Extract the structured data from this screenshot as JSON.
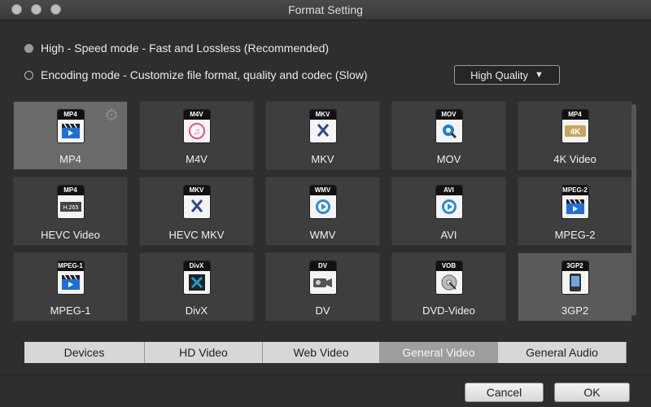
{
  "window": {
    "title": "Format Setting"
  },
  "modes": [
    {
      "label": "High - Speed mode - Fast and Lossless (Recommended)",
      "selected": true
    },
    {
      "label": "Encoding mode - Customize file format, quality and codec (Slow)",
      "selected": false
    }
  ],
  "quality": {
    "value": "High Quality",
    "arrow": "▼"
  },
  "formats": [
    {
      "label": "MP4",
      "badge": "MP4",
      "icon": "clapper-icon",
      "color": "#1e6fd9"
    },
    {
      "label": "M4V",
      "badge": "M4V",
      "icon": "itunes-icon",
      "color": "#e84a8a"
    },
    {
      "label": "MKV",
      "badge": "MKV",
      "icon": "mkv-logo-icon",
      "color": "#2a4d8a"
    },
    {
      "label": "MOV",
      "badge": "MOV",
      "icon": "quicktime-icon",
      "color": "#1f7fd6"
    },
    {
      "label": "4K Video",
      "badge": "MP4",
      "icon": "4k-icon",
      "color": "#c9a45c"
    },
    {
      "label": "HEVC Video",
      "badge": "MP4",
      "icon": "h265-icon",
      "color": "#444444"
    },
    {
      "label": "HEVC MKV",
      "badge": "MKV",
      "icon": "mkv-logo-icon",
      "color": "#2a4d8a"
    },
    {
      "label": "WMV",
      "badge": "WMV",
      "icon": "media-player-icon",
      "color": "#2c8adf"
    },
    {
      "label": "AVI",
      "badge": "AVI",
      "icon": "media-player-icon",
      "color": "#2c8adf"
    },
    {
      "label": "MPEG-2",
      "badge": "MPEG-2",
      "icon": "clapper-icon",
      "color": "#1e6fd9"
    },
    {
      "label": "MPEG-1",
      "badge": "MPEG-1",
      "icon": "clapper-icon",
      "color": "#1e6fd9"
    },
    {
      "label": "DivX",
      "badge": "DivX",
      "icon": "divx-icon",
      "color": "#1d9bd7"
    },
    {
      "label": "DV",
      "badge": "DV",
      "icon": "camcorder-icon",
      "color": "#555555"
    },
    {
      "label": "DVD-Video",
      "badge": "VOB",
      "icon": "dvd-disc-icon",
      "color": "#555555"
    },
    {
      "label": "3GP2",
      "badge": "3GP2",
      "icon": "phone-icon",
      "color": "#333333"
    }
  ],
  "selected_formats": [
    "MP4",
    "3GP2"
  ],
  "tabs": [
    {
      "label": "Devices"
    },
    {
      "label": "HD Video"
    },
    {
      "label": "Web Video"
    },
    {
      "label": "General Video",
      "active": true
    },
    {
      "label": "General Audio"
    }
  ],
  "buttons": {
    "cancel": "Cancel",
    "ok": "OK"
  }
}
